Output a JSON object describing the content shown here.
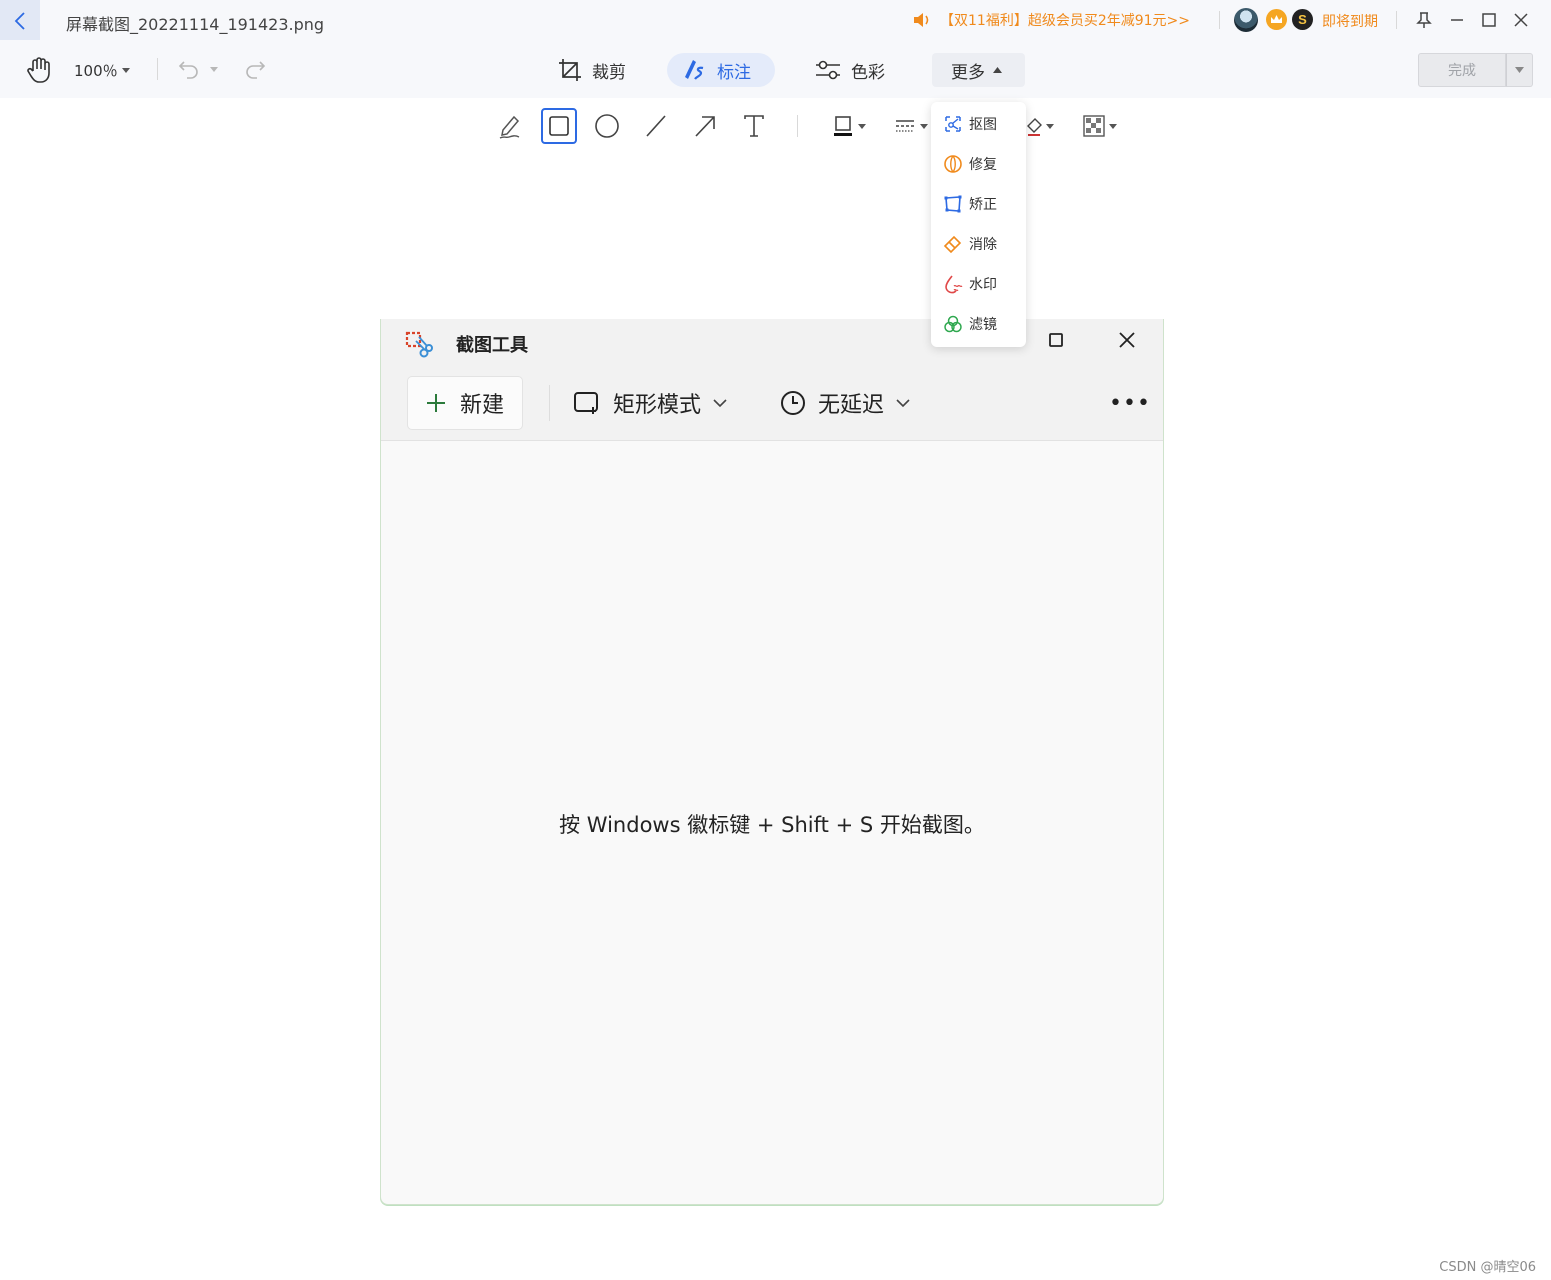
{
  "titlebar": {
    "file_name": "屏幕截图_20221114_191423.png",
    "promo_text": "【双11福利】超级会员买2年减91元>>",
    "expiry_text": "即将到期",
    "badge_s": "S"
  },
  "toolbar": {
    "zoom": "100％",
    "tabs": [
      {
        "label": "裁剪",
        "icon": "crop-icon"
      },
      {
        "label": "标注",
        "icon": "annotate-icon",
        "active": true
      },
      {
        "label": "色彩",
        "icon": "color-adjust-icon"
      },
      {
        "label": "更多",
        "icon": "caret-up-icon"
      }
    ],
    "done_label": "完成"
  },
  "annotation_tools": [
    "pen-tool",
    "rectangle-tool",
    "ellipse-tool",
    "line-tool",
    "arrow-tool",
    "text-tool",
    "border-color",
    "line-style",
    "fill",
    "mosaic"
  ],
  "more_menu": {
    "items": [
      {
        "label": "抠图",
        "icon": "cutout-icon",
        "color": "#2d6ae3"
      },
      {
        "label": "修复",
        "icon": "repair-icon",
        "color": "#f08a1c"
      },
      {
        "label": "矫正",
        "icon": "correct-icon",
        "color": "#2d6ae3"
      },
      {
        "label": "消除",
        "icon": "eraser-icon",
        "color": "#f08a1c"
      },
      {
        "label": "水印",
        "icon": "watermark-icon",
        "color": "#e04848"
      },
      {
        "label": "滤镜",
        "icon": "filter-icon",
        "color": "#2fa84f"
      }
    ]
  },
  "snip_tool": {
    "title": "截图工具",
    "new_label": "新建",
    "mode_label": "矩形模式",
    "delay_label": "无延迟",
    "more_label": "•••",
    "hint": "按 Windows 徽标键 + Shift + S 开始截图。"
  },
  "watermark": "CSDN @晴空06",
  "colors": {
    "accent": "#2d6ae3",
    "promo": "#f08a1c"
  }
}
